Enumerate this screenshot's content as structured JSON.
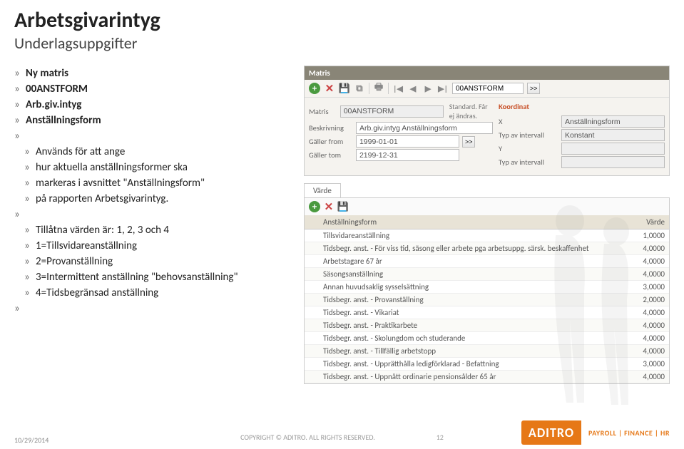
{
  "title": "Arbetsgivarintyg",
  "subtitle": "Underlagsuppgifter",
  "bullets": {
    "b1": "Ny matris",
    "b2": "00ANSTFORM",
    "b3": "Arb.giv.intyg",
    "b4": "Anställningsform",
    "b5": "Används för att ange",
    "b6": "hur aktuella anställningsformer ska",
    "b7": "markeras i avsnittet \"Anställningsform\"",
    "b8": "på rapporten Arbetsgivarintyg.",
    "b9": "Tillåtna värden är: 1, 2, 3 och 4",
    "b10": "1=Tillsvidareanställning",
    "b11": "2=Provanställning",
    "b12": "3=Intermittent anställning \"behovsanställning\"",
    "b13": "4=Tidsbegränsad anställning"
  },
  "panel": {
    "header": "Matris",
    "searchValue": "00ANSTFORM",
    "go": ">>",
    "form": {
      "matrisLabel": "Matris",
      "matrisValue": "00ANSTFORM",
      "matrisNote": "Standard. Får ej ändras.",
      "beskLabel": "Beskrivning",
      "beskValue": "Arb.giv.intyg Anställningsform",
      "fromLabel": "Gäller from",
      "fromValue": "1999-01-01",
      "tomLabel": "Gäller tom",
      "tomValue": "2199-12-31",
      "koordHeader": "Koordinat",
      "xLabel": "X",
      "xValue": "Anställningsform",
      "typXLabel": "Typ av intervall",
      "typXValue": "Konstant",
      "yLabel": "Y",
      "yValue": "",
      "typYLabel": "Typ av intervall",
      "typYValue": ""
    }
  },
  "tabLabel": "Värde",
  "tableHeaders": {
    "c1": "Anställningsform",
    "c2": "Värde"
  },
  "rows": [
    {
      "a": "Tillsvidareanställning",
      "v": "1,0000"
    },
    {
      "a": "Tidsbegr. anst. - För viss tid, säsong eller arbete pga arbetsuppg. särsk. beskaffenhet",
      "v": "4,0000"
    },
    {
      "a": "Arbetstagare 67 år",
      "v": "4,0000"
    },
    {
      "a": "Säsongsanställning",
      "v": "4,0000"
    },
    {
      "a": "Annan huvudsaklig sysselsättning",
      "v": "3,0000"
    },
    {
      "a": "Tidsbegr. anst. - Provanställning",
      "v": "2,0000"
    },
    {
      "a": "Tidsbegr. anst. - Vikariat",
      "v": "4,0000"
    },
    {
      "a": "Tidsbegr. anst. - Praktikarbete",
      "v": "4,0000"
    },
    {
      "a": "Tidsbegr. anst. - Skolungdom och studerande",
      "v": "4,0000"
    },
    {
      "a": "Tidsbegr. anst. - Tillfällig arbetstopp",
      "v": "4,0000"
    },
    {
      "a": "Tidsbegr. anst. - Upprätthålla ledigförklarad - Befattning",
      "v": "3,0000"
    },
    {
      "a": "Tidsbegr. anst. - Uppnått ordinarie pensionsålder 65 år",
      "v": "4,0000"
    }
  ],
  "footer": {
    "date": "10/29/2014",
    "copyright": "COPYRIGHT © ADITRO. ALL RIGHTS RESERVED.",
    "pageNum": "12",
    "logoText": "ADITRO",
    "logoTag": "PAYROLL | FINANCE | HR"
  }
}
